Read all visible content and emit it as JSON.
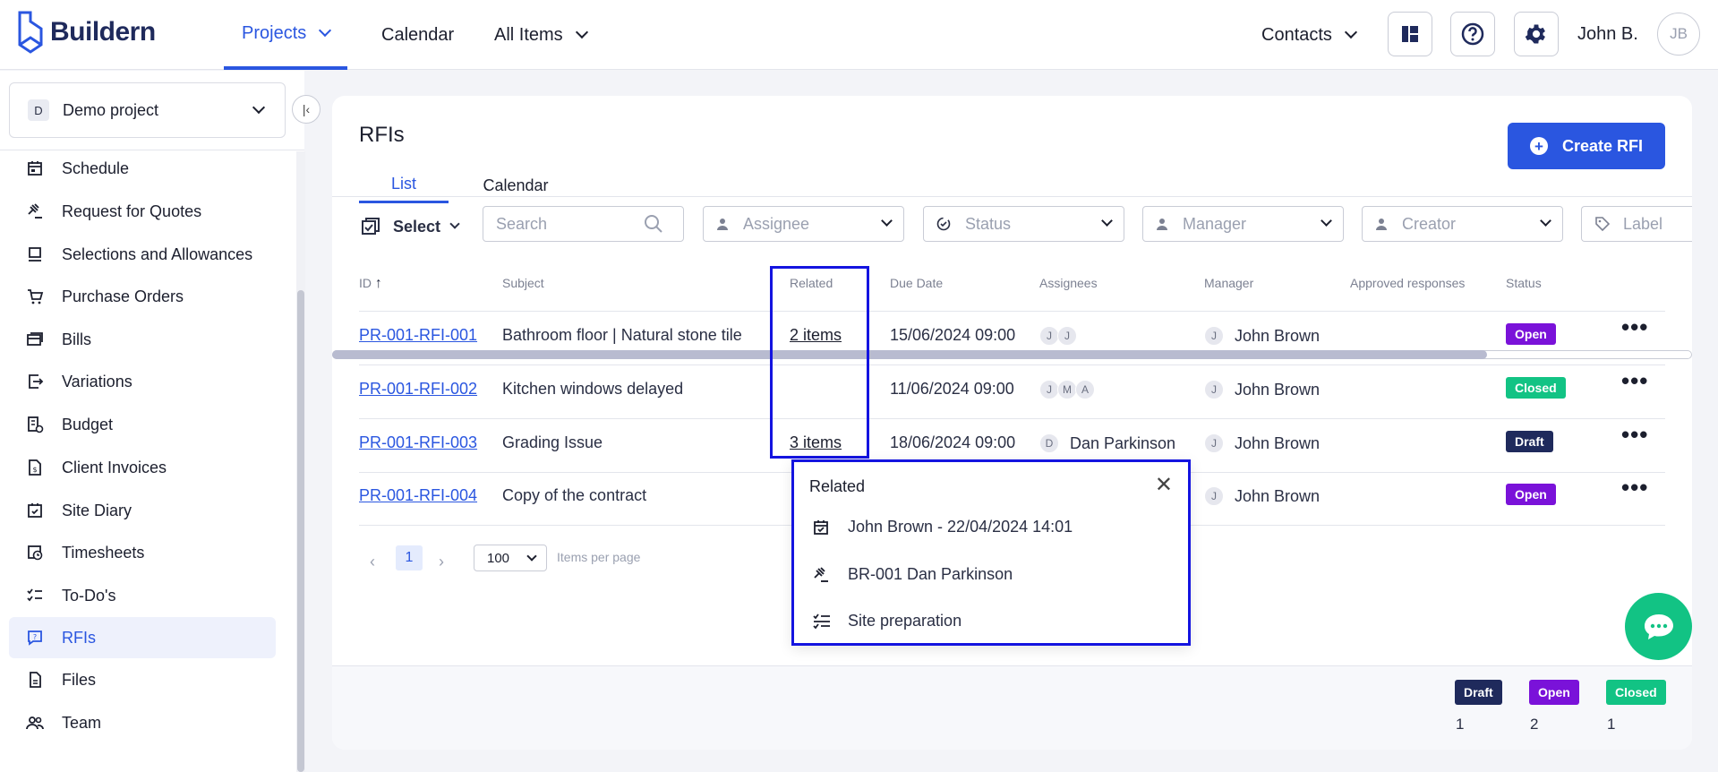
{
  "brand": {
    "name": "Buildern"
  },
  "nav": {
    "projects": "Projects",
    "calendar": "Calendar",
    "all_items": "All Items",
    "contacts": "Contacts",
    "user_name": "John B.",
    "user_initials": "JB"
  },
  "sidebar": {
    "project_initial": "D",
    "project_name": "Demo project",
    "items": [
      {
        "label": "Schedule",
        "icon": "schedule-icon"
      },
      {
        "label": "Request for Quotes",
        "icon": "gavel-icon"
      },
      {
        "label": "Selections and Allowances",
        "icon": "selections-icon"
      },
      {
        "label": "Purchase Orders",
        "icon": "cart-icon"
      },
      {
        "label": "Bills",
        "icon": "bills-icon"
      },
      {
        "label": "Variations",
        "icon": "variations-icon"
      },
      {
        "label": "Budget",
        "icon": "budget-icon"
      },
      {
        "label": "Client Invoices",
        "icon": "invoice-icon"
      },
      {
        "label": "Site Diary",
        "icon": "diary-icon"
      },
      {
        "label": "Timesheets",
        "icon": "timesheet-icon"
      },
      {
        "label": "To-Do's",
        "icon": "todo-icon"
      },
      {
        "label": "RFIs",
        "icon": "rfi-icon",
        "active": true
      },
      {
        "label": "Files",
        "icon": "file-icon"
      },
      {
        "label": "Team",
        "icon": "team-icon"
      }
    ]
  },
  "page": {
    "title": "RFIs",
    "create_label": "Create RFI",
    "tabs": [
      "List",
      "Calendar"
    ]
  },
  "filters": {
    "select_label": "Select",
    "search_placeholder": "Search",
    "assignee": "Assignee",
    "status": "Status",
    "manager": "Manager",
    "creator": "Creator",
    "label": "Label"
  },
  "table": {
    "headers": [
      "ID",
      "Subject",
      "Related",
      "Due Date",
      "Assignees",
      "Manager",
      "Approved responses",
      "Status"
    ],
    "rows": [
      {
        "id": "PR-001-RFI-001",
        "subject": "Bathroom floor | Natural stone tile",
        "related": "2 items",
        "due": "15/06/2024 09:00",
        "assignee_avatars": [
          "J",
          "J"
        ],
        "assignee_name": "",
        "manager_initial": "J",
        "manager": "John Brown",
        "status": "Open"
      },
      {
        "id": "PR-001-RFI-002",
        "subject": "Kitchen windows delayed",
        "related": "",
        "due": "11/06/2024 09:00",
        "assignee_avatars": [
          "J",
          "M",
          "A"
        ],
        "assignee_name": "",
        "manager_initial": "J",
        "manager": "John Brown",
        "status": "Closed"
      },
      {
        "id": "PR-001-RFI-003",
        "subject": "Grading Issue",
        "related": "3 items",
        "due": "18/06/2024 09:00",
        "assignee_avatars": [
          "D"
        ],
        "assignee_name": "Dan Parkinson",
        "manager_initial": "J",
        "manager": "John Brown",
        "status": "Draft"
      },
      {
        "id": "PR-001-RFI-004",
        "subject": "Copy of the contract",
        "related": "",
        "due": "",
        "assignee_avatars": [],
        "assignee_name": "",
        "manager_initial": "J",
        "manager": "John Brown",
        "status": "Open"
      }
    ]
  },
  "pagination": {
    "current_page": "1",
    "per_page": "100",
    "per_page_label": "Items per page"
  },
  "popup": {
    "title": "Related",
    "items": [
      {
        "label": "John Brown - 22/04/2024 14:01",
        "icon": "calendar-check-icon"
      },
      {
        "label": "BR-001 Dan Parkinson",
        "icon": "gavel-icon"
      },
      {
        "label": "Site preparation",
        "icon": "checklist-icon"
      }
    ]
  },
  "summary": [
    {
      "label": "Draft",
      "count": "1"
    },
    {
      "label": "Open",
      "count": "2"
    },
    {
      "label": "Closed",
      "count": "1"
    }
  ],
  "colors": {
    "accent": "#2a56e0",
    "open": "#7a12d9",
    "closed": "#12c384",
    "draft": "#1f2a5c",
    "highlight": "#1414e0"
  }
}
